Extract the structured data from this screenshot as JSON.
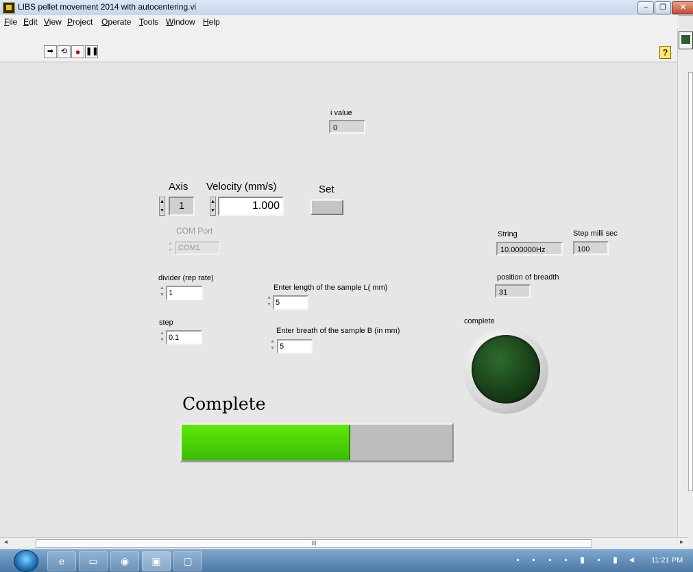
{
  "window": {
    "title": "LIBS pellet movement 2014 with autocentering.vi",
    "controls": [
      "–",
      "❐",
      "✕"
    ]
  },
  "menu": [
    "File",
    "Edit",
    "View",
    "Project",
    "Operate",
    "Tools",
    "Window",
    "Help"
  ],
  "toolbar": {
    "run_icon": "run-arrow-icon",
    "run_cont_icon": "run-continuously-icon",
    "abort_icon": "abort-icon",
    "pause_icon": "pause-icon",
    "help": "?"
  },
  "front_panel": {
    "i_value": {
      "label": "i value",
      "value": "0"
    },
    "axis": {
      "label": "Axis",
      "value": "1"
    },
    "velocity": {
      "label": "Velocity (mm/s)",
      "value": "1.000"
    },
    "set": {
      "label": "Set"
    },
    "com_port": {
      "label": "COM Port",
      "value": "COM1"
    },
    "string": {
      "label": "String",
      "value": "10.000000Hz"
    },
    "step_ms": {
      "label": "Step milli  sec",
      "value": "100"
    },
    "divider": {
      "label": "divider (rep rate)",
      "value": "1"
    },
    "length": {
      "label": "Enter length of the sample L( mm)",
      "value": "5"
    },
    "breadth_pos": {
      "label": "position of breadth",
      "value": "31"
    },
    "step": {
      "label": "step",
      "value": "0.1"
    },
    "breath": {
      "label": "Enter breath of the sample  B (in mm)",
      "value": "5"
    },
    "complete_led": {
      "label": "complete",
      "on": false,
      "color": "#173d17"
    },
    "progress": {
      "label": "Complete",
      "fraction": 0.62,
      "color": "#4fd608"
    }
  },
  "scrollbar": {
    "grip": "III"
  },
  "taskbar": {
    "clock": "11:21 PM",
    "apps": [
      "ie-icon",
      "folder-icon",
      "chrome-icon",
      "labview-icon",
      "app-icon"
    ]
  }
}
